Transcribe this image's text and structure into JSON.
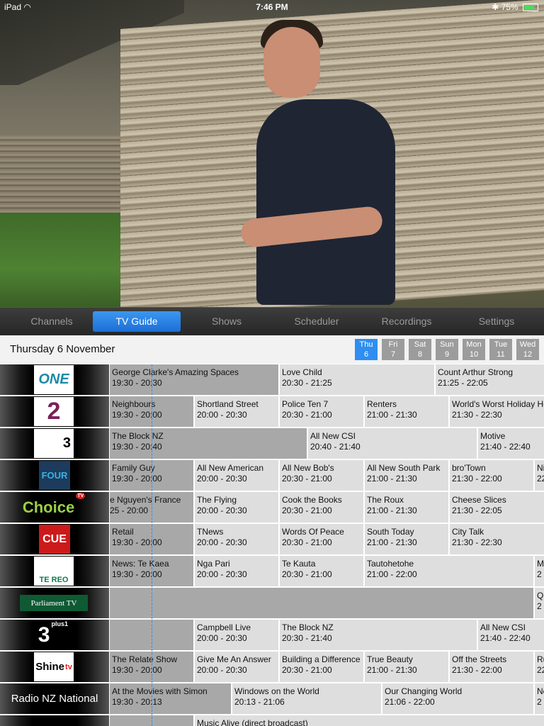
{
  "status_bar": {
    "device": "iPad",
    "time": "7:46 PM",
    "battery": "75%",
    "battery_level": 0.75
  },
  "tabs": [
    {
      "label": "Channels",
      "active": false
    },
    {
      "label": "TV Guide",
      "active": true
    },
    {
      "label": "Shows",
      "active": false
    },
    {
      "label": "Scheduler",
      "active": false
    },
    {
      "label": "Recordings",
      "active": false
    },
    {
      "label": "Settings",
      "active": false
    }
  ],
  "date_title": "Thursday 6 November",
  "days": [
    {
      "dow": "Thu",
      "num": "6",
      "active": true
    },
    {
      "dow": "Fri",
      "num": "7",
      "active": false
    },
    {
      "dow": "Sat",
      "num": "8",
      "active": false
    },
    {
      "dow": "Sun",
      "num": "9",
      "active": false
    },
    {
      "dow": "Mon",
      "num": "10",
      "active": false
    },
    {
      "dow": "Tue",
      "num": "11",
      "active": false
    },
    {
      "dow": "Wed",
      "num": "12",
      "active": false
    }
  ],
  "colors": {
    "accent": "#2f8ef0",
    "past_cell": "#a8a8a8",
    "future_cell": "#dedede"
  },
  "channels": [
    {
      "key": "one",
      "logo": "ONE",
      "programs": [
        {
          "title": "George Clarke's Amazing Spaces",
          "time": "19:30 - 20:30",
          "past": true
        },
        {
          "title": "Love Child",
          "time": "20:30 - 21:25"
        },
        {
          "title": "Count Arthur Strong",
          "time": "21:25 - 22:05"
        }
      ]
    },
    {
      "key": "two",
      "logo": "2",
      "programs": [
        {
          "title": "Neighbours",
          "time": "19:30 - 20:00",
          "past": true
        },
        {
          "title": "Shortland Street",
          "time": "20:00 - 20:30"
        },
        {
          "title": "Police Ten 7",
          "time": "20:30 - 21:00"
        },
        {
          "title": "Renters",
          "time": "21:00 - 21:30"
        },
        {
          "title": "World's Worst Holiday Ho",
          "time": "21:30 - 22:30"
        }
      ]
    },
    {
      "key": "three",
      "logo": "3",
      "programs": [
        {
          "title": "The Block NZ",
          "time": "19:30 - 20:40",
          "past": true
        },
        {
          "title": "All New CSI",
          "time": "20:40 - 21:40"
        },
        {
          "title": "Motive",
          "time": "21:40 - 22:40"
        }
      ]
    },
    {
      "key": "four",
      "logo": "FOUR",
      "programs": [
        {
          "title": "Family Guy",
          "time": "19:30 - 20:00",
          "past": true
        },
        {
          "title": "All New American",
          "time": "20:00 - 20:30"
        },
        {
          "title": "All New Bob's",
          "time": "20:30 - 21:00"
        },
        {
          "title": "All New South Park",
          "time": "21:00 - 21:30"
        },
        {
          "title": "bro'Town",
          "time": "21:30 - 22:00"
        },
        {
          "title": "Ni",
          "time": "22"
        }
      ]
    },
    {
      "key": "choice",
      "logo": "Choice",
      "badge": "TV",
      "programs": [
        {
          "title": "e Nguyen's France",
          "time": "25 - 20:00",
          "past": true,
          "cut": true
        },
        {
          "title": "The Flying",
          "time": "20:00 - 20:30"
        },
        {
          "title": "Cook the Books",
          "time": "20:30 - 21:00"
        },
        {
          "title": "The Roux",
          "time": "21:00 - 21:30"
        },
        {
          "title": "Cheese Slices",
          "time": "21:30 - 22:05"
        }
      ]
    },
    {
      "key": "cue",
      "logo": "CUE",
      "programs": [
        {
          "title": "Retail",
          "time": "19:30 - 20:00",
          "past": true
        },
        {
          "title": "TNews",
          "time": "20:00 - 20:30"
        },
        {
          "title": "Words Of Peace",
          "time": "20:30 - 21:00"
        },
        {
          "title": "South Today",
          "time": "21:00 - 21:30"
        },
        {
          "title": "City Talk",
          "time": "21:30 - 22:30"
        }
      ]
    },
    {
      "key": "tereo",
      "logo": "TE REO",
      "programs": [
        {
          "title": "News: Te Kaea",
          "time": "19:30 - 20:00",
          "past": true
        },
        {
          "title": "Nga Pari",
          "time": "20:00 - 20:30"
        },
        {
          "title": "Te Kauta",
          "time": "20:30 - 21:00"
        },
        {
          "title": "Tautohetohe",
          "time": "21:00 - 22:00"
        },
        {
          "title": "M",
          "time": "2"
        }
      ]
    },
    {
      "key": "parliament",
      "logo": "Parliament TV",
      "programs": [
        {
          "title": "",
          "time": "",
          "past": true
        },
        {
          "title": "Q",
          "time": "2"
        }
      ]
    },
    {
      "key": "threeplus1",
      "logo": "3",
      "badge": "plus1",
      "programs": [
        {
          "title": "",
          "time": "",
          "past": true
        },
        {
          "title": "Campbell Live",
          "time": "20:00 - 20:30"
        },
        {
          "title": "The Block NZ",
          "time": "20:30 - 21:40"
        },
        {
          "title": "All New CSI",
          "time": "21:40 - 22:40"
        }
      ]
    },
    {
      "key": "shine",
      "logo": "Shine",
      "badge": "tv",
      "programs": [
        {
          "title": "The Relate Show",
          "time": "19:30 - 20:00",
          "past": true
        },
        {
          "title": "Give Me An Answer",
          "time": "20:00 - 20:30"
        },
        {
          "title": "Building a Difference",
          "time": "20:30 - 21:00"
        },
        {
          "title": "True Beauty",
          "time": "21:00 - 21:30"
        },
        {
          "title": "Off the Streets",
          "time": "21:30 - 22:00"
        },
        {
          "title": "Ru",
          "time": "22"
        }
      ]
    },
    {
      "key": "radionz",
      "logo": "Radio NZ National",
      "programs": [
        {
          "title": "At the Movies with Simon",
          "time": "19:30 - 20:13",
          "past": true
        },
        {
          "title": "Windows on the World",
          "time": "20:13 - 21:06"
        },
        {
          "title": "Our Changing World",
          "time": "21:06 - 22:00"
        },
        {
          "title": "Ne",
          "time": "2"
        }
      ]
    },
    {
      "key": "last",
      "logo": "",
      "programs": [
        {
          "title": "",
          "time": "",
          "past": true
        },
        {
          "title": "Music Alive (direct broadcast)",
          "time": ""
        }
      ]
    }
  ]
}
